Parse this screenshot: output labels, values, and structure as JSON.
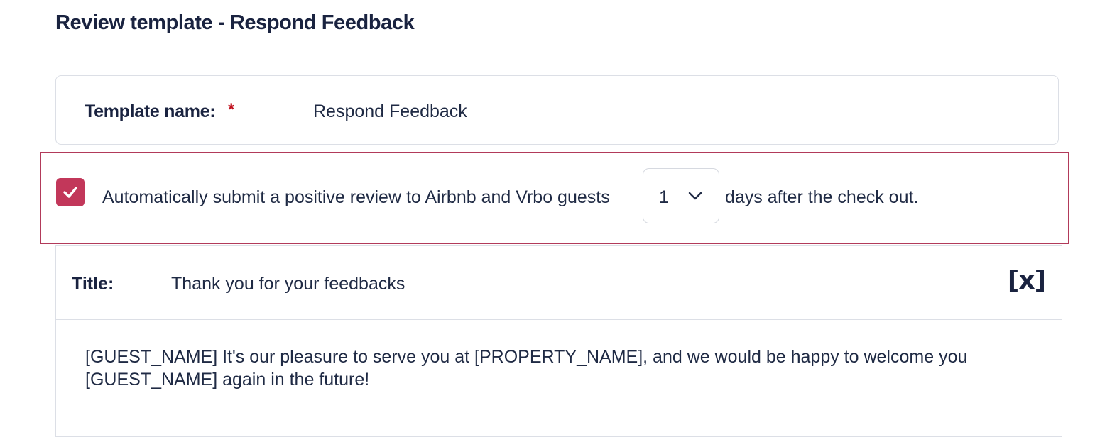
{
  "page": {
    "title": "Review template - Respond Feedback"
  },
  "template_name": {
    "label": "Template name:",
    "required_marker": "*",
    "value": "Respond Feedback"
  },
  "auto_review": {
    "checked": true,
    "text_before": "Automatically submit a positive review to Airbnb and Vrbo guests",
    "days_selected": "1",
    "text_after": "days after the check out."
  },
  "review": {
    "title_label": "Title:",
    "title_value": "Thank you for your feedbacks",
    "variable_button_label": "[x]",
    "body_line_1": "[GUEST_NAME] It's our pleasure to serve you at [PROPERTY_NAME], and we would be happy to welcome you",
    "body_line_2": "[GUEST_NAME] again in the future!"
  },
  "colors": {
    "accent": "#c2375a",
    "highlight_border": "#b23a5a",
    "required": "#c1121f",
    "text": "#1f2a44",
    "border": "#dcdfe6"
  },
  "icons": {
    "checkbox": "check-icon",
    "dropdown": "chevron-down-icon",
    "insert_variable": "variable-icon"
  }
}
